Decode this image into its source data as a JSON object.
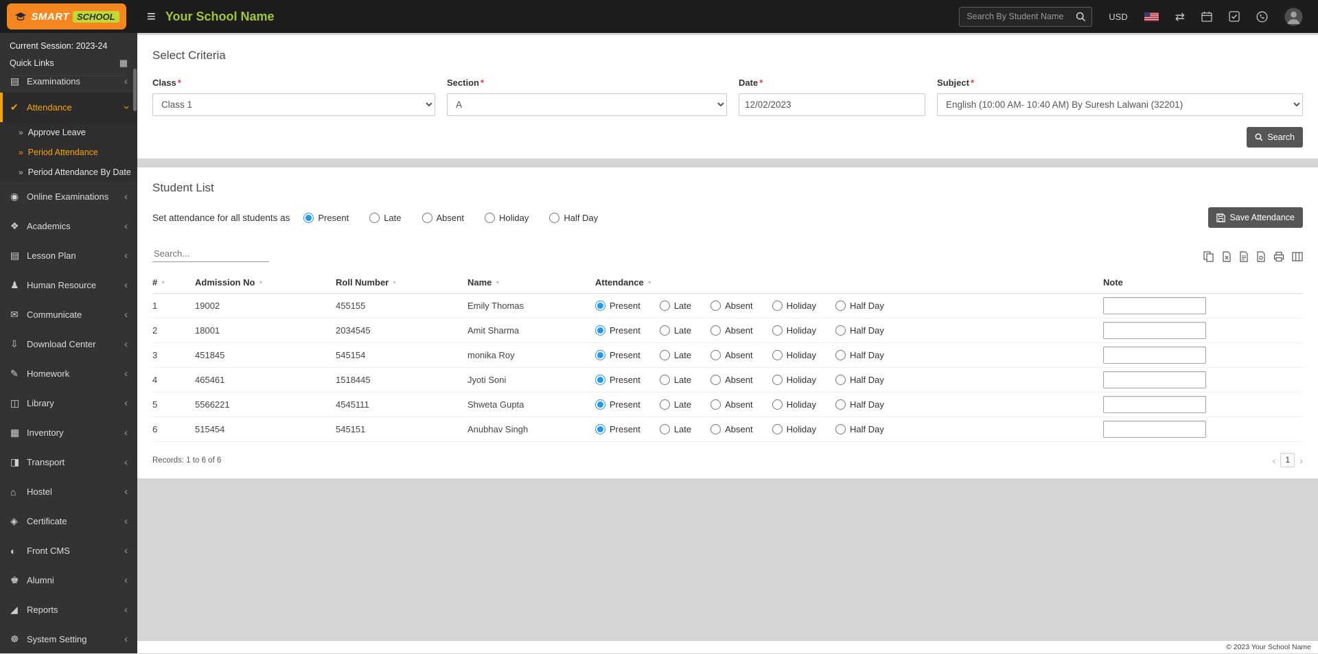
{
  "topbar": {
    "logo_word1": "SMART",
    "logo_word2": "SCHOOL",
    "school_name": "Your School Name",
    "search_placeholder": "Search By Student Name",
    "currency_label": "USD",
    "icons": [
      "menu-icon",
      "search-icon",
      "language-flag-icon",
      "exchange-icon",
      "calendar-icon",
      "task-check-icon",
      "whatsapp-icon",
      "user-avatar-icon"
    ]
  },
  "sidebar": {
    "session": "Current Session: 2023-24",
    "quick_links": "Quick Links",
    "partial_item": "Examinations",
    "sub_arrow": "»",
    "attendance": {
      "label": "Attendance",
      "icon": "✔",
      "subitems": [
        {
          "label": "Approve Leave",
          "active": false
        },
        {
          "label": "Period Attendance",
          "active": true
        },
        {
          "label": "Period Attendance By Date",
          "active": false
        }
      ]
    },
    "menus": [
      {
        "label": "Online Examinations",
        "icon": "◉"
      },
      {
        "label": "Academics",
        "icon": "❖"
      },
      {
        "label": "Lesson Plan",
        "icon": "▤"
      },
      {
        "label": "Human Resource",
        "icon": "♟"
      },
      {
        "label": "Communicate",
        "icon": "✉"
      },
      {
        "label": "Download Center",
        "icon": "⇩"
      },
      {
        "label": "Homework",
        "icon": "✎"
      },
      {
        "label": "Library",
        "icon": "◫"
      },
      {
        "label": "Inventory",
        "icon": "▦"
      },
      {
        "label": "Transport",
        "icon": "◨"
      },
      {
        "label": "Hostel",
        "icon": "⌂"
      },
      {
        "label": "Certificate",
        "icon": "◈"
      },
      {
        "label": "Front CMS",
        "icon": "◐"
      },
      {
        "label": "Alumni",
        "icon": "♚"
      },
      {
        "label": "Reports",
        "icon": "◢"
      },
      {
        "label": "System Setting",
        "icon": "☸"
      }
    ]
  },
  "criteria": {
    "title": "Select Criteria",
    "required_mark": "*",
    "class_label": "Class",
    "class_value": "Class 1",
    "section_label": "Section",
    "section_value": "A",
    "date_label": "Date",
    "date_value": "12/02/2023",
    "subject_label": "Subject",
    "subject_value": "English (10:00 AM- 10:40 AM) By Suresh Lalwani (32201)",
    "search_button": "Search"
  },
  "student_list": {
    "title": "Student List",
    "set_all_label": "Set attendance for all students as",
    "attendance_options": [
      "Present",
      "Late",
      "Absent",
      "Holiday",
      "Half Day"
    ],
    "selected_option": "Present",
    "save_button": "Save Attendance",
    "filter_placeholder": "Search...",
    "export_icons": [
      "copy-icon",
      "excel-icon",
      "csv-icon",
      "pdf-icon",
      "print-icon",
      "columns-icon"
    ],
    "columns": [
      "#",
      "Admission No",
      "Roll Number",
      "Name",
      "Attendance",
      "Note"
    ],
    "rows": [
      {
        "num": "1",
        "admission_no": "19002",
        "roll_number": "455155",
        "name": "Emily Thomas",
        "attendance": "Present",
        "note": ""
      },
      {
        "num": "2",
        "admission_no": "18001",
        "roll_number": "2034545",
        "name": "Amit Sharma",
        "attendance": "Present",
        "note": ""
      },
      {
        "num": "3",
        "admission_no": "451845",
        "roll_number": "545154",
        "name": "monika Roy",
        "attendance": "Present",
        "note": ""
      },
      {
        "num": "4",
        "admission_no": "465461",
        "roll_number": "1518445",
        "name": "Jyoti Soni",
        "attendance": "Present",
        "note": ""
      },
      {
        "num": "5",
        "admission_no": "5566221",
        "roll_number": "4545111",
        "name": "Shweta Gupta",
        "attendance": "Present",
        "note": ""
      },
      {
        "num": "6",
        "admission_no": "515454",
        "roll_number": "545151",
        "name": "Anubhav Singh",
        "attendance": "Present",
        "note": ""
      }
    ],
    "records_text": "Records: 1 to 6 of 6",
    "page_number": "1"
  },
  "footer": {
    "copyright": "© 2023 Your School Name"
  }
}
